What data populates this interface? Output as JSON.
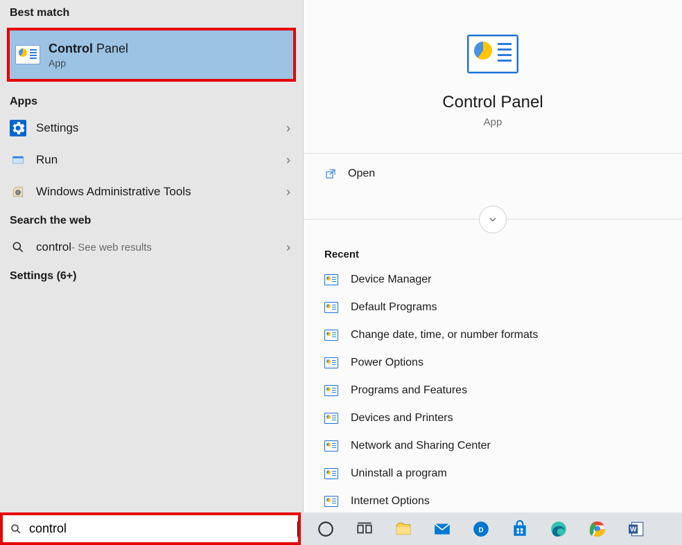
{
  "left": {
    "section_best_match": "Best match",
    "best_match": {
      "title_bold": "Control",
      "title_rest": " Panel",
      "subtitle": "App"
    },
    "section_apps": "Apps",
    "apps": [
      {
        "label": "Settings",
        "icon": "settings"
      },
      {
        "label": "Run",
        "icon": "run"
      },
      {
        "label": "Windows Administrative Tools",
        "icon": "wat"
      }
    ],
    "section_web": "Search the web",
    "web": {
      "query": "control",
      "suffix": " - See web results"
    },
    "section_settings": "Settings (6+)"
  },
  "right": {
    "title": "Control Panel",
    "subtitle": "App",
    "open_label": "Open",
    "recent_header": "Recent",
    "recent": [
      "Device Manager",
      "Default Programs",
      "Change date, time, or number formats",
      "Power Options",
      "Programs and Features",
      "Devices and Printers",
      "Network and Sharing Center",
      "Uninstall a program",
      "Internet Options"
    ]
  },
  "search": {
    "value": "control"
  }
}
